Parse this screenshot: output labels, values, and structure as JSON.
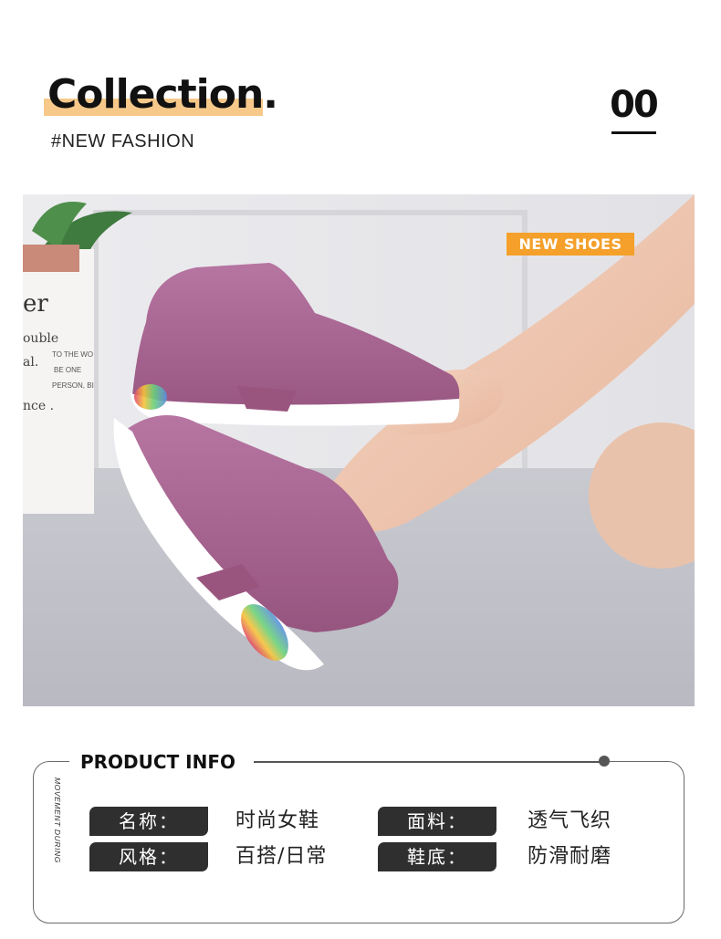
{
  "header": {
    "title": "Collection.",
    "subtitle": "#NEW FASHION",
    "index": "00"
  },
  "photo": {
    "badge": "NEW SHOES",
    "bag_text_large": "er",
    "bag_text_line1": "ouble",
    "bag_text_line2": "al.",
    "bag_text_line3": "nce .",
    "bag_small_1": "TO THE WO",
    "bag_small_2": "BE ONE",
    "bag_small_3": "PERSON, BI"
  },
  "product_info": {
    "title": "PRODUCT INFO",
    "side_text": "MOVEMENT DURING",
    "rows": [
      {
        "label": "名称：",
        "value": "时尚女鞋"
      },
      {
        "label": "面料：",
        "value": "透气飞织"
      },
      {
        "label": "风格：",
        "value": "百搭/日常"
      },
      {
        "label": "鞋底：",
        "value": "防滑耐磨"
      }
    ]
  },
  "colors": {
    "accent": "#f4a02a",
    "highlight": "#f6c98a",
    "shoe": "#a6628f",
    "label_bg": "#2f2f2f"
  }
}
